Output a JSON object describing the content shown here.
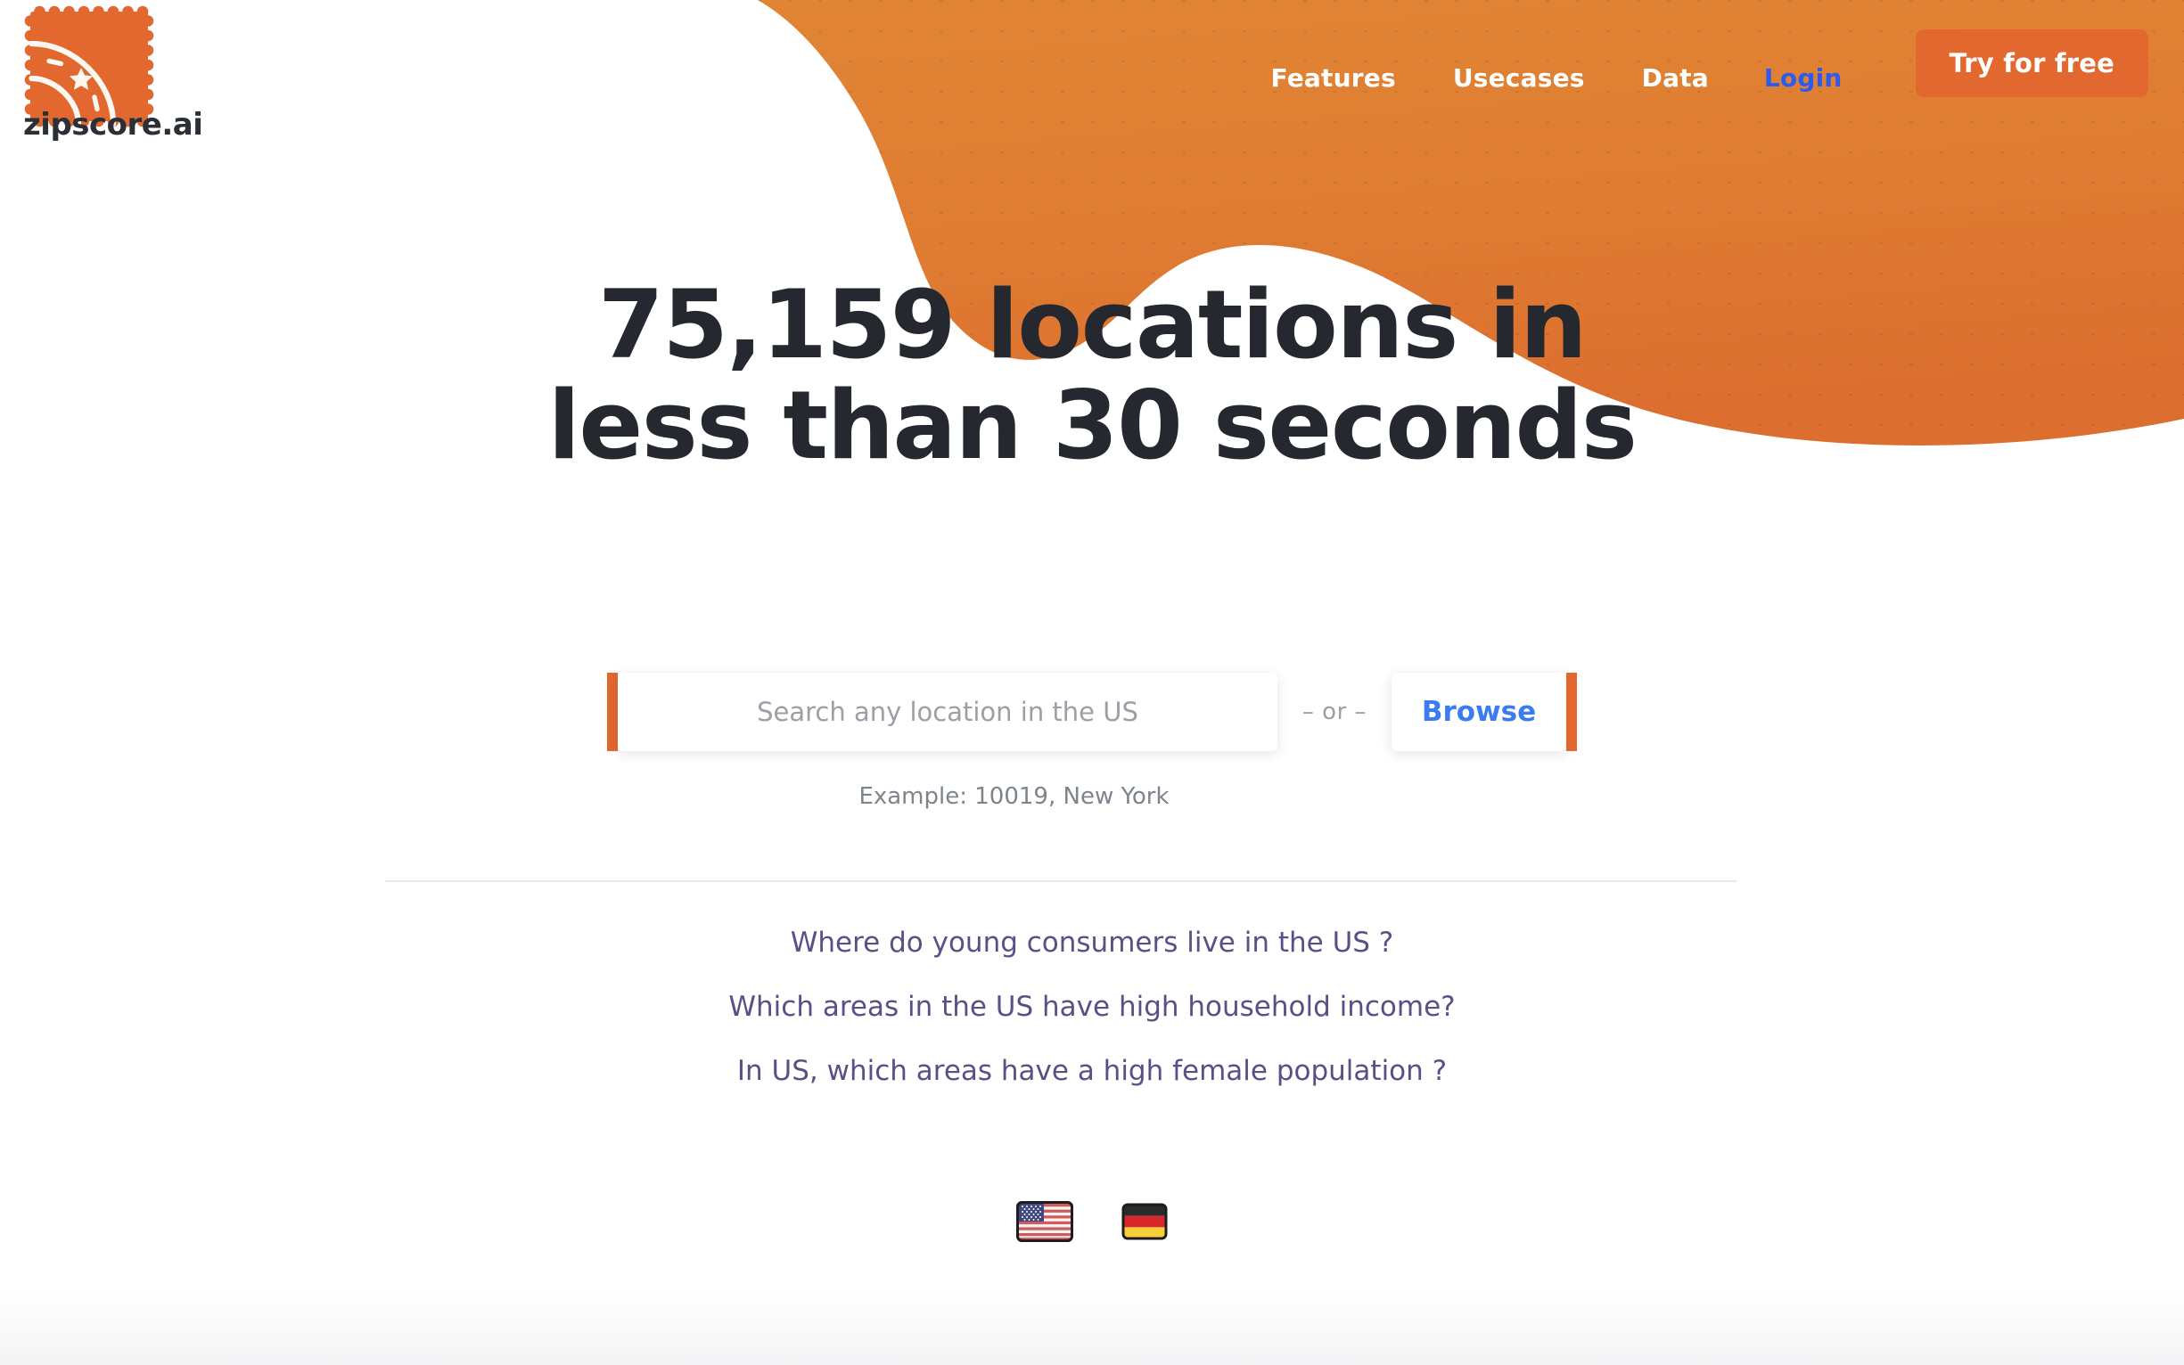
{
  "brand": {
    "logo_icon": "stamp-road-star-icon",
    "name": "zipscore.ai",
    "accent_orange": "#e2682f",
    "blob_orange_top": "#e08534",
    "blob_orange_bottom": "#dd7030"
  },
  "nav": {
    "items": [
      {
        "label": "Features",
        "name": "features",
        "color": "#ffffff"
      },
      {
        "label": "Usecases",
        "name": "usecases",
        "color": "#ffffff"
      },
      {
        "label": "Data",
        "name": "data",
        "color": "#ffffff"
      },
      {
        "label": "Login",
        "name": "login",
        "color": "#2d5bf0"
      }
    ],
    "cta_label": "Try for free"
  },
  "hero": {
    "headline_line1": "75,159 locations in",
    "headline_line2": "less than 30 seconds",
    "headline_color": "#25292f",
    "location_count": "75,159",
    "seconds": "30"
  },
  "search": {
    "placeholder": "Search any location in the US",
    "value": "",
    "separator": "– or –",
    "browse_label": "Browse",
    "browse_color": "#3b7df0",
    "example_text": "Example: 10019, New York"
  },
  "questions": [
    {
      "text": "Where do young consumers live in the US ?",
      "name": "young-consumers"
    },
    {
      "text": "Which areas in the US have high household income?",
      "name": "household-income"
    },
    {
      "text": "In US, which areas have a high female population ?",
      "name": "female-population"
    }
  ],
  "questions_color": "#565285",
  "languages": [
    {
      "name": "flag-us-icon",
      "label": "United States"
    },
    {
      "name": "flag-de-icon",
      "label": "Germany"
    }
  ]
}
